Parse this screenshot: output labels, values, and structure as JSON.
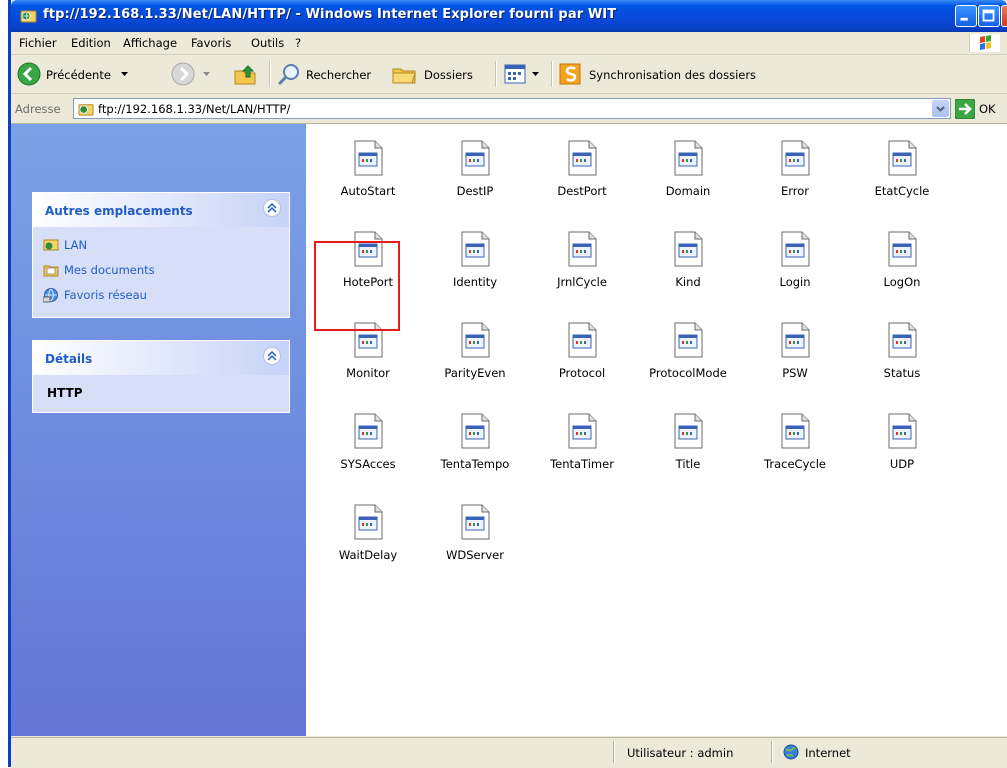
{
  "window": {
    "title": "ftp://192.168.1.33/Net/LAN/HTTP/ - Windows Internet Explorer fourni par WIT"
  },
  "menu": [
    "Fichier",
    "Edition",
    "Affichage",
    "Favoris",
    "Outils",
    "?"
  ],
  "toolbar": {
    "back_label": "Précédente",
    "search_label": "Rechercher",
    "folders_label": "Dossiers",
    "sync_label": "Synchronisation des dossiers"
  },
  "address": {
    "label": "Adresse",
    "value": "ftp://192.168.1.33/Net/LAN/HTTP/",
    "go_label": "OK"
  },
  "sidebar": {
    "other_places": {
      "title": "Autres emplacements",
      "items": [
        {
          "label": "LAN",
          "icon": "network-folder-icon"
        },
        {
          "label": "Mes documents",
          "icon": "folder-icon"
        },
        {
          "label": "Favoris réseau",
          "icon": "network-places-icon"
        }
      ]
    },
    "details": {
      "title": "Détails",
      "name": "HTTP"
    }
  },
  "files": [
    "AutoStart",
    "DestIP",
    "DestPort",
    "Domain",
    "Error",
    "EtatCycle",
    "HotePort",
    "Identity",
    "JrnlCycle",
    "Kind",
    "Login",
    "LogOn",
    "Monitor",
    "ParityEven",
    "Protocol",
    "ProtocolMode",
    "PSW",
    "Status",
    "SYSAcces",
    "TentaTempo",
    "TentaTimer",
    "Title",
    "TraceCycle",
    "UDP",
    "WaitDelay",
    "WDServer"
  ],
  "highlighted_file": "HotePort",
  "status": {
    "user": "Utilisateur : admin",
    "zone": "Internet"
  },
  "colors": {
    "titlebar": "#0a48d8",
    "sidebar": "#6f8ce0",
    "link": "#215dc6",
    "highlight": "#e41c1c"
  }
}
